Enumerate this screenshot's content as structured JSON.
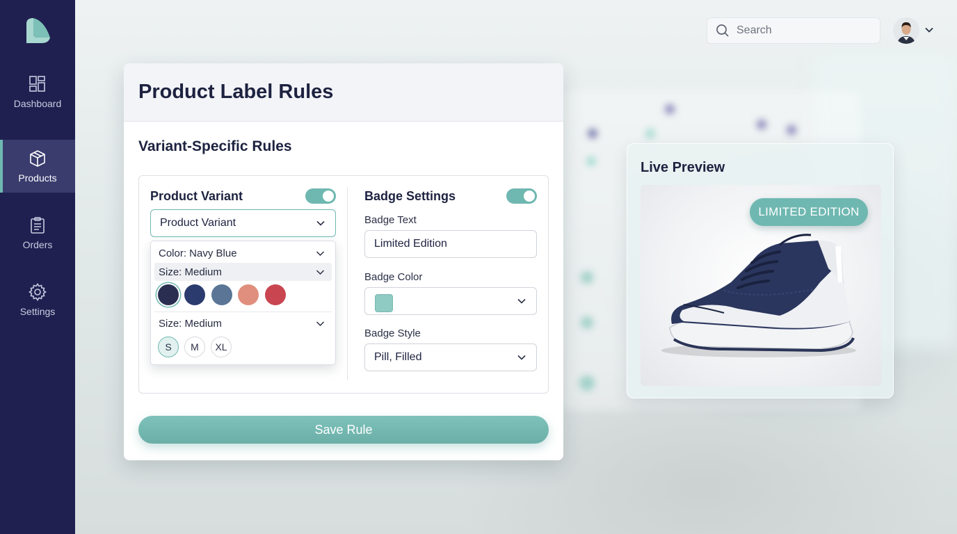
{
  "colors": {
    "sidebar": "#1f2050",
    "accent": "#6fb8b1",
    "swatches": [
      "#2a2f52",
      "#2c3b6e",
      "#5a7595",
      "#e08e7d",
      "#c94650"
    ],
    "badge_color": "#8fcac3"
  },
  "sidebar": {
    "items": [
      {
        "label": "Dashboard",
        "icon": "dashboard-icon",
        "active": false
      },
      {
        "label": "Products",
        "icon": "box-icon",
        "active": true
      },
      {
        "label": "Orders",
        "icon": "clipboard-icon",
        "active": false
      },
      {
        "label": "Settings",
        "icon": "gear-icon",
        "active": false
      }
    ]
  },
  "header": {
    "search_placeholder": "Search"
  },
  "card": {
    "title": "Product Label Rules",
    "section_title": "Variant-Specific Rules",
    "variant": {
      "label": "Product Variant",
      "toggle_on": true,
      "select_value": "Product Variant",
      "menu": {
        "color_row": "Color: Navy Blue",
        "size_row_highlight": "Size: Medium",
        "size_row": "Size: Medium",
        "sizes": [
          "S",
          "M",
          "XL"
        ],
        "selected_size": "S"
      }
    },
    "badge": {
      "label": "Badge Settings",
      "toggle_on": true,
      "text_label": "Badge Text",
      "text_value": "Limited Edition",
      "color_label": "Badge Color",
      "style_label": "Badge Style",
      "style_value": "Pill, Filled"
    },
    "save_label": "Save Rule"
  },
  "preview": {
    "title": "Live Preview",
    "badge_text": "LIMITED EDITION"
  }
}
